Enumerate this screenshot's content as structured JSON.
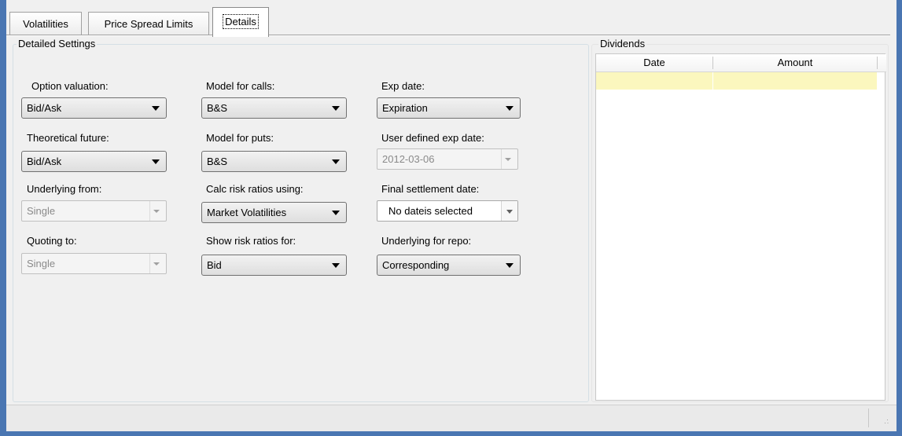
{
  "tabs": [
    {
      "label": "Volatilities",
      "active": false
    },
    {
      "label": "Price Spread Limits",
      "active": false
    },
    {
      "label": "Details",
      "active": true
    }
  ],
  "detailed_settings": {
    "title": "Detailed Settings",
    "option_valuation": {
      "label": "Option valuation:",
      "value": "Bid/Ask"
    },
    "theoretical_future": {
      "label": "Theoretical future:",
      "value": "Bid/Ask"
    },
    "underlying_from": {
      "label": "Underlying from:",
      "value": "Single",
      "enabled": false
    },
    "quoting_to": {
      "label": "Quoting to:",
      "value": "Single",
      "enabled": false
    },
    "model_for_calls": {
      "label": "Model for calls:",
      "value": "B&S"
    },
    "model_for_puts": {
      "label": "Model for puts:",
      "value": "B&S"
    },
    "calc_risk_ratios": {
      "label": "Calc risk ratios using:",
      "value": "Market Volatilities"
    },
    "show_risk_ratios": {
      "label": "Show risk ratios for:",
      "value": "Bid"
    },
    "exp_date": {
      "label": "Exp date:",
      "value": "Expiration"
    },
    "user_exp_date": {
      "label": "User defined exp date:",
      "value": "2012-03-06",
      "enabled": false
    },
    "final_settlement_date": {
      "label": "Final settlement date:",
      "value": "No dateis selected"
    },
    "underlying_for_repo": {
      "label": "Underlying for repo:",
      "value": "Corresponding"
    }
  },
  "dividends": {
    "title": "Dividends",
    "columns": [
      "Date",
      "Amount"
    ],
    "rows": [
      [
        "",
        ""
      ]
    ]
  },
  "icons": {
    "combo_arrow": "chevron-down-icon",
    "resize_grip": "resize-grip-icon"
  }
}
